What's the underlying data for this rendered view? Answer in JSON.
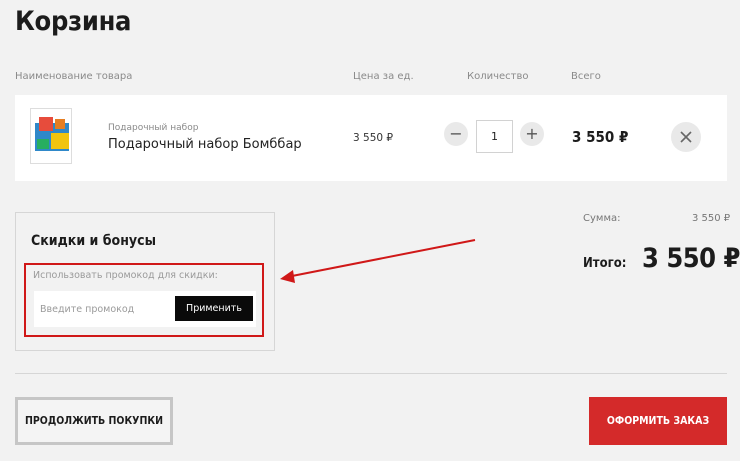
{
  "page": {
    "title": "Корзина"
  },
  "columns": {
    "name": "Наименование товара",
    "price": "Цена за ед.",
    "quantity": "Количество",
    "total": "Всего"
  },
  "item": {
    "category": "Подарочный набор",
    "name": "Подарочный набор Бомббар",
    "unit_price": "3 550 ₽",
    "quantity": "1",
    "total": "3 550 ₽",
    "minus": "−",
    "plus": "+"
  },
  "discount": {
    "title": "Скидки и бонусы",
    "promo_label": "Использовать промокод для скидки:",
    "promo_placeholder": "Введите промокод",
    "apply_label": "Применить"
  },
  "summary": {
    "sum_label": "Сумма:",
    "sum_value": "3 550 ₽",
    "total_label": "Итого:",
    "total_value": "3 550 ₽"
  },
  "actions": {
    "continue_label": "ПРОДОЛЖИТЬ ПОКУПКИ",
    "checkout_label": "ОФОРМИТЬ ЗАКАЗ"
  },
  "colors": {
    "accent": "#d42a2a",
    "highlight": "#d01818",
    "background": "#f2f2f2"
  }
}
